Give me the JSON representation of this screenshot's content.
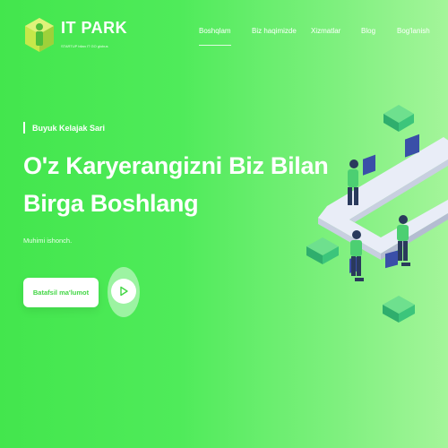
{
  "brand": {
    "name": "IT PARK",
    "tagline": "STARTUP bilan IT GO globus"
  },
  "nav": {
    "items": [
      {
        "label": "Boshqlam",
        "active": true
      },
      {
        "label": "Biz haqimizde",
        "active": false
      },
      {
        "label": "Xizmatlar",
        "active": false
      },
      {
        "label": "Blog",
        "active": false
      },
      {
        "label": "Bog'lanish",
        "active": false
      }
    ]
  },
  "hero": {
    "kicker": "Buyuk Kelajak Sari",
    "headline_line1": "O'z Karyerangizni Biz Bilan",
    "headline_line2": "Birga Boshlang",
    "subtitle": "Muhimi ishonch.",
    "cta_label": "Batafsil ma'lumot",
    "play_icon": "play-icon"
  },
  "colors": {
    "accent": "#43d645",
    "background_start": "#43e64d",
    "background_end": "#a4f59a"
  }
}
